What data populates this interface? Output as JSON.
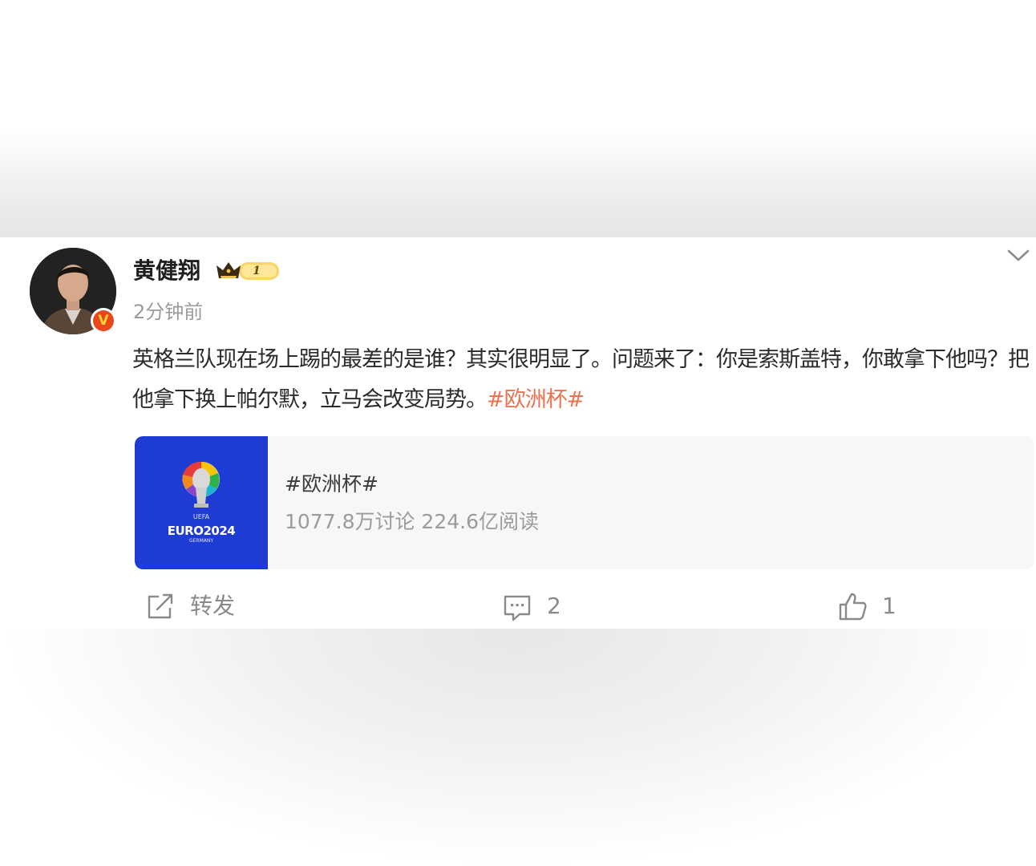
{
  "post": {
    "author": "黄健翔",
    "vip_level": "1",
    "verified_mark": "V",
    "timestamp": "2分钟前",
    "text": "英格兰队现在场上踢的最差的是谁？其实很明显了。问题来了：你是索斯盖特，你敢拿下他吗？把他拿下换上帕尔默，立马会改变局势。",
    "hashtag": "#欧洲杯#",
    "colors": {
      "hashtag": "#eb7350",
      "verified_badge": "#e8471c",
      "topic_image_bg": "#1e3bd4"
    }
  },
  "topic_card": {
    "title": "#欧洲杯#",
    "stats": "1077.8万讨论 224.6亿阅读",
    "logo_text": "EURO2024",
    "logo_small_top": "UEFA",
    "logo_small_bottom": "GERMANY"
  },
  "actions": {
    "repost_label": "转发",
    "comment_count": "2",
    "like_count": "1",
    "icons": [
      "repost-icon",
      "comment-icon",
      "like-icon",
      "chevron-down-icon",
      "crown-icon"
    ]
  }
}
